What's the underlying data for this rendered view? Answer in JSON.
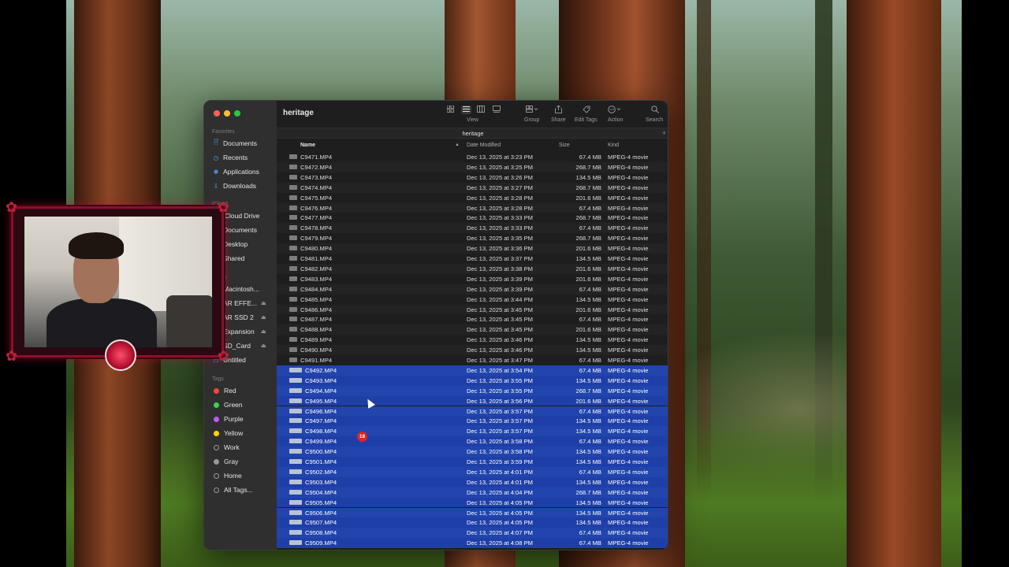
{
  "window": {
    "title": "heritage"
  },
  "toolbar": {
    "view_label": "View",
    "group_label": "Group",
    "share_label": "Share",
    "edit_tags_label": "Edit Tags",
    "action_label": "Action",
    "search_label": "Search"
  },
  "pathbar": {
    "current": "heritage",
    "add_symbol": "+"
  },
  "columns": {
    "name": "Name",
    "date": "Date Modified",
    "size": "Size",
    "kind": "Kind"
  },
  "sidebar": {
    "favorites_heading": "Favorites",
    "favorites": [
      {
        "label": "Documents",
        "icon": "document-icon"
      },
      {
        "label": "Recents",
        "icon": "clock-icon"
      },
      {
        "label": "Applications",
        "icon": "applications-icon"
      },
      {
        "label": "Downloads",
        "icon": "download-icon"
      }
    ],
    "icloud_heading": "iCloud",
    "icloud": [
      {
        "label": "iCloud Drive",
        "icon": "cloud-icon"
      },
      {
        "label": "Documents",
        "icon": "document-icon"
      },
      {
        "label": "Desktop",
        "icon": "desktop-icon"
      },
      {
        "label": "Shared",
        "icon": "shared-folder-icon"
      }
    ],
    "locations_heading": "ations",
    "locations": [
      {
        "label": "Macintosh...",
        "icon": "disk-icon"
      },
      {
        "label": "AR EFFE...",
        "icon": "disk-icon"
      },
      {
        "label": "AR SSD 2",
        "icon": "disk-icon"
      },
      {
        "label": "Expansion",
        "icon": "disk-icon"
      },
      {
        "label": "SD_Card",
        "icon": "disk-icon"
      },
      {
        "label": "Untitled",
        "icon": "disk-icon"
      }
    ],
    "tags_heading": "Tags",
    "tags": [
      {
        "label": "Red",
        "color": "#ff453a"
      },
      {
        "label": "Green",
        "color": "#32d74b"
      },
      {
        "label": "Purple",
        "color": "#bf5af2"
      },
      {
        "label": "Yellow",
        "color": "#ffd60a"
      },
      {
        "label": "Work",
        "color": ""
      },
      {
        "label": "Gray",
        "color": "#98989d"
      },
      {
        "label": "Home",
        "color": ""
      },
      {
        "label": "All Tags...",
        "color": ""
      }
    ]
  },
  "files": [
    {
      "name": "C9471.MP4",
      "date": "Dec 13, 2025 at 3:23 PM",
      "size": "67.4 MB",
      "kind": "MPEG-4 movie",
      "selected": false
    },
    {
      "name": "C9472.MP4",
      "date": "Dec 13, 2025 at 3:25 PM",
      "size": "268.7 MB",
      "kind": "MPEG-4 movie",
      "selected": false
    },
    {
      "name": "C9473.MP4",
      "date": "Dec 13, 2025 at 3:26 PM",
      "size": "134.5 MB",
      "kind": "MPEG-4 movie",
      "selected": false
    },
    {
      "name": "C9474.MP4",
      "date": "Dec 13, 2025 at 3:27 PM",
      "size": "268.7 MB",
      "kind": "MPEG-4 movie",
      "selected": false
    },
    {
      "name": "C9475.MP4",
      "date": "Dec 13, 2025 at 3:28 PM",
      "size": "201.6 MB",
      "kind": "MPEG-4 movie",
      "selected": false
    },
    {
      "name": "C9476.MP4",
      "date": "Dec 13, 2025 at 3:28 PM",
      "size": "67.4 MB",
      "kind": "MPEG-4 movie",
      "selected": false
    },
    {
      "name": "C9477.MP4",
      "date": "Dec 13, 2025 at 3:33 PM",
      "size": "268.7 MB",
      "kind": "MPEG-4 movie",
      "selected": false
    },
    {
      "name": "C9478.MP4",
      "date": "Dec 13, 2025 at 3:33 PM",
      "size": "67.4 MB",
      "kind": "MPEG-4 movie",
      "selected": false
    },
    {
      "name": "C9479.MP4",
      "date": "Dec 13, 2025 at 3:35 PM",
      "size": "268.7 MB",
      "kind": "MPEG-4 movie",
      "selected": false
    },
    {
      "name": "C9480.MP4",
      "date": "Dec 13, 2025 at 3:36 PM",
      "size": "201.6 MB",
      "kind": "MPEG-4 movie",
      "selected": false
    },
    {
      "name": "C9481.MP4",
      "date": "Dec 13, 2025 at 3:37 PM",
      "size": "134.5 MB",
      "kind": "MPEG-4 movie",
      "selected": false
    },
    {
      "name": "C9482.MP4",
      "date": "Dec 13, 2025 at 3:38 PM",
      "size": "201.6 MB",
      "kind": "MPEG-4 movie",
      "selected": false
    },
    {
      "name": "C9483.MP4",
      "date": "Dec 13, 2025 at 3:39 PM",
      "size": "201.6 MB",
      "kind": "MPEG-4 movie",
      "selected": false
    },
    {
      "name": "C9484.MP4",
      "date": "Dec 13, 2025 at 3:39 PM",
      "size": "67.4 MB",
      "kind": "MPEG-4 movie",
      "selected": false
    },
    {
      "name": "C9485.MP4",
      "date": "Dec 13, 2025 at 3:44 PM",
      "size": "134.5 MB",
      "kind": "MPEG-4 movie",
      "selected": false
    },
    {
      "name": "C9486.MP4",
      "date": "Dec 13, 2025 at 3:45 PM",
      "size": "201.6 MB",
      "kind": "MPEG-4 movie",
      "selected": false
    },
    {
      "name": "C9487.MP4",
      "date": "Dec 13, 2025 at 3:45 PM",
      "size": "67.4 MB",
      "kind": "MPEG-4 movie",
      "selected": false
    },
    {
      "name": "C9488.MP4",
      "date": "Dec 13, 2025 at 3:45 PM",
      "size": "201.6 MB",
      "kind": "MPEG-4 movie",
      "selected": false
    },
    {
      "name": "C9489.MP4",
      "date": "Dec 13, 2025 at 3:46 PM",
      "size": "134.5 MB",
      "kind": "MPEG-4 movie",
      "selected": false
    },
    {
      "name": "C9490.MP4",
      "date": "Dec 13, 2025 at 3:46 PM",
      "size": "134.5 MB",
      "kind": "MPEG-4 movie",
      "selected": false
    },
    {
      "name": "C9491.MP4",
      "date": "Dec 13, 2025 at 3:47 PM",
      "size": "67.4 MB",
      "kind": "MPEG-4 movie",
      "selected": false
    },
    {
      "name": "C9492.MP4",
      "date": "Dec 13, 2025 at 3:54 PM",
      "size": "67.4 MB",
      "kind": "MPEG-4 movie",
      "selected": true
    },
    {
      "name": "C9493.MP4",
      "date": "Dec 13, 2025 at 3:55 PM",
      "size": "134.5 MB",
      "kind": "MPEG-4 movie",
      "selected": true
    },
    {
      "name": "C9494.MP4",
      "date": "Dec 13, 2025 at 3:55 PM",
      "size": "268.7 MB",
      "kind": "MPEG-4 movie",
      "selected": true
    },
    {
      "name": "C9495.MP4",
      "date": "Dec 13, 2025 at 3:56 PM",
      "size": "201.6 MB",
      "kind": "MPEG-4 movie",
      "selected": true
    },
    {
      "name": "C9496.MP4",
      "date": "Dec 13, 2025 at 3:57 PM",
      "size": "67.4 MB",
      "kind": "MPEG-4 movie",
      "selected": true
    },
    {
      "name": "C9497.MP4",
      "date": "Dec 13, 2025 at 3:57 PM",
      "size": "134.5 MB",
      "kind": "MPEG-4 movie",
      "selected": true
    },
    {
      "name": "C9498.MP4",
      "date": "Dec 13, 2025 at 3:57 PM",
      "size": "134.5 MB",
      "kind": "MPEG-4 movie",
      "selected": true
    },
    {
      "name": "C9499.MP4",
      "date": "Dec 13, 2025 at 3:58 PM",
      "size": "67.4 MB",
      "kind": "MPEG-4 movie",
      "selected": true
    },
    {
      "name": "C9500.MP4",
      "date": "Dec 13, 2025 at 3:58 PM",
      "size": "134.5 MB",
      "kind": "MPEG-4 movie",
      "selected": true
    },
    {
      "name": "C9501.MP4",
      "date": "Dec 13, 2025 at 3:59 PM",
      "size": "134.5 MB",
      "kind": "MPEG-4 movie",
      "selected": true
    },
    {
      "name": "C9502.MP4",
      "date": "Dec 13, 2025 at 4:01 PM",
      "size": "67.4 MB",
      "kind": "MPEG-4 movie",
      "selected": true
    },
    {
      "name": "C9503.MP4",
      "date": "Dec 13, 2025 at 4:01 PM",
      "size": "134.5 MB",
      "kind": "MPEG-4 movie",
      "selected": true
    },
    {
      "name": "C9504.MP4",
      "date": "Dec 13, 2025 at 4:04 PM",
      "size": "268.7 MB",
      "kind": "MPEG-4 movie",
      "selected": true
    },
    {
      "name": "C9505.MP4",
      "date": "Dec 13, 2025 at 4:05 PM",
      "size": "134.5 MB",
      "kind": "MPEG-4 movie",
      "selected": true
    },
    {
      "name": "C9506.MP4",
      "date": "Dec 13, 2025 at 4:05 PM",
      "size": "134.5 MB",
      "kind": "MPEG-4 movie",
      "selected": true
    },
    {
      "name": "C9507.MP4",
      "date": "Dec 13, 2025 at 4:05 PM",
      "size": "134.5 MB",
      "kind": "MPEG-4 movie",
      "selected": true
    },
    {
      "name": "C9508.MP4",
      "date": "Dec 13, 2025 at 4:07 PM",
      "size": "67.4 MB",
      "kind": "MPEG-4 movie",
      "selected": true
    },
    {
      "name": "C9509.MP4",
      "date": "Dec 13, 2025 at 4:08 PM",
      "size": "67.4 MB",
      "kind": "MPEG-4 movie",
      "selected": true
    }
  ],
  "drag_badge": {
    "count": "18"
  },
  "colors": {
    "selection": "#1f3fa8",
    "close": "#ff5f57",
    "minimize": "#febc2e",
    "zoom": "#28c840",
    "webcam_border": "#8c0f2a"
  }
}
